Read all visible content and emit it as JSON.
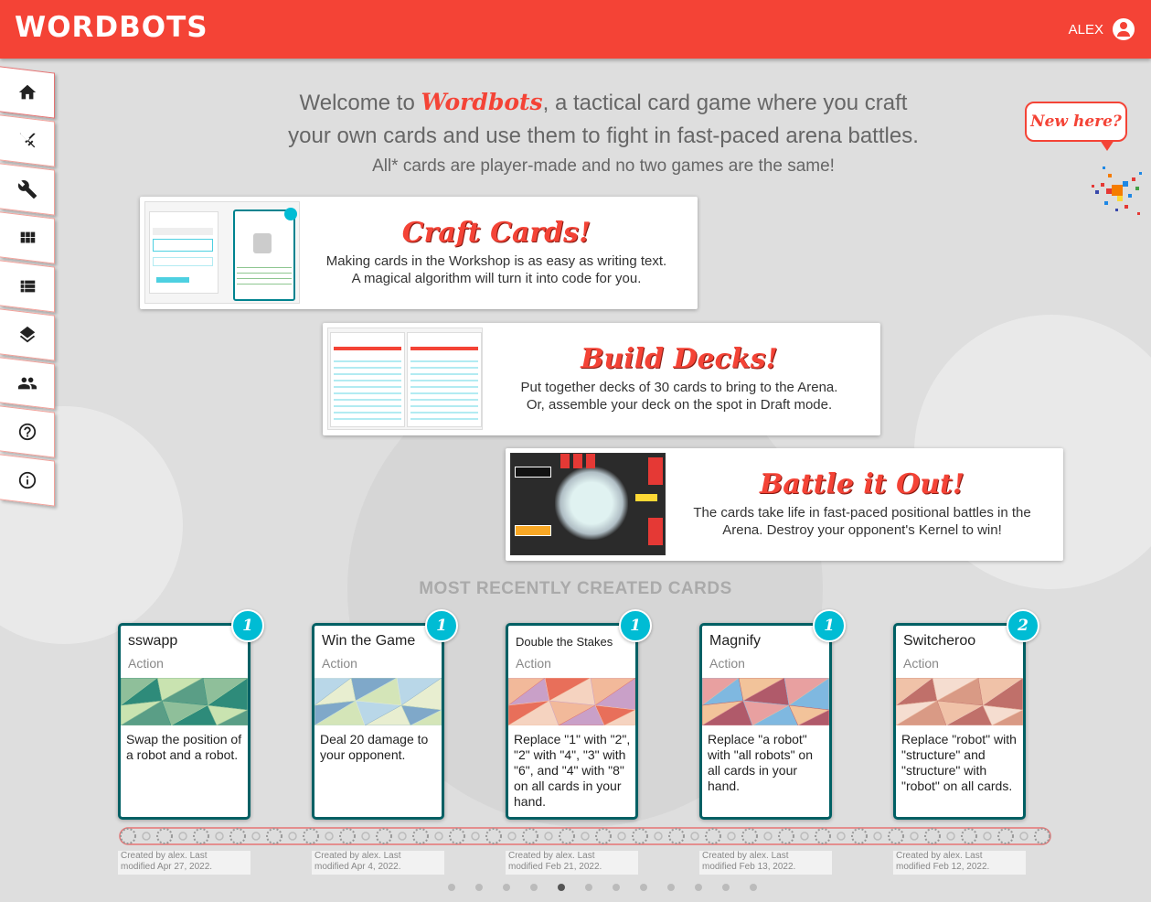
{
  "app": {
    "logo": "WORDBOTS",
    "user": "ALEX"
  },
  "sidebar": [
    {
      "name": "home-icon",
      "active": true
    },
    {
      "name": "swords-icon"
    },
    {
      "name": "wrench-icon"
    },
    {
      "name": "grid-icon"
    },
    {
      "name": "list-icon"
    },
    {
      "name": "layers-icon"
    },
    {
      "name": "people-icon"
    },
    {
      "name": "help-icon"
    },
    {
      "name": "info-icon"
    }
  ],
  "intro": {
    "welcome": "Welcome to",
    "brand": "Wordbots",
    "line1_rest": ", a tactical card game where you craft",
    "line2": "your own cards and use them to fight in fast-paced arena battles.",
    "sub": "All* cards are player-made and no two games are the same!"
  },
  "new_here": "New here?",
  "features": [
    {
      "title": "Craft Cards!",
      "line1": "Making cards in the Workshop is as easy as writing text.",
      "line2": "A magical algorithm will turn it into code for you."
    },
    {
      "title": "Build Decks!",
      "line1": "Put together decks of 30 cards to bring to the Arena.",
      "line2": "Or, assemble your deck on the spot in Draft mode."
    },
    {
      "title": "Battle it Out!",
      "line1": "The cards take life in fast-paced positional battles in the",
      "line2": "Arena. Destroy your opponent's Kernel to win!"
    }
  ],
  "section_title": "MOST RECENTLY CREATED CARDS",
  "cards": [
    {
      "name": "sswapp",
      "type": "Action",
      "cost": "1",
      "text": "Swap the position of a robot and a robot.",
      "meta1": "Created by alex. Last",
      "meta2": "modified Apr 27, 2022.",
      "colors": [
        "#8fbf9a",
        "#2e8b7a",
        "#c9e3b0",
        "#5a9e86"
      ]
    },
    {
      "name": "Win the Game",
      "type": "Action",
      "cost": "1",
      "text": "Deal 20 damage to your opponent.",
      "meta1": "Created by alex. Last",
      "meta2": "modified Apr 4, 2022.",
      "colors": [
        "#b9d7e8",
        "#e8eed0",
        "#7fa8c9",
        "#d4e5b8"
      ]
    },
    {
      "name": "Double the Stakes",
      "type": "Action",
      "cost": "1",
      "text": "Replace \"1\" with \"2\", \"2\" with \"4\", \"3\" with \"6\", and \"4\" with \"8\" on all cards in your hand.",
      "meta1": "Created by alex. Last",
      "meta2": "modified Feb 21, 2022.",
      "colors": [
        "#f2b99a",
        "#c9a0c8",
        "#e86f5a",
        "#f5d3c0"
      ]
    },
    {
      "name": "Magnify",
      "type": "Action",
      "cost": "1",
      "text": "Replace \"a robot\" with \"all robots\" on all cards in your hand.",
      "meta1": "Created by alex. Last",
      "meta2": "modified Feb 13, 2022.",
      "colors": [
        "#e8a0a0",
        "#7fb8e0",
        "#f2c39a",
        "#b05a6a"
      ]
    },
    {
      "name": "Switcheroo",
      "type": "Action",
      "cost": "2",
      "text": "Replace \"robot\" with \"structure\" and \"structure\" with \"robot\" on all cards.",
      "meta1": "Created by alex. Last",
      "meta2": "modified Feb 12, 2022.",
      "colors": [
        "#f0c2a8",
        "#c0706a",
        "#f5ddd0",
        "#d99a85"
      ]
    }
  ],
  "dots": 12,
  "active_dot": 4
}
